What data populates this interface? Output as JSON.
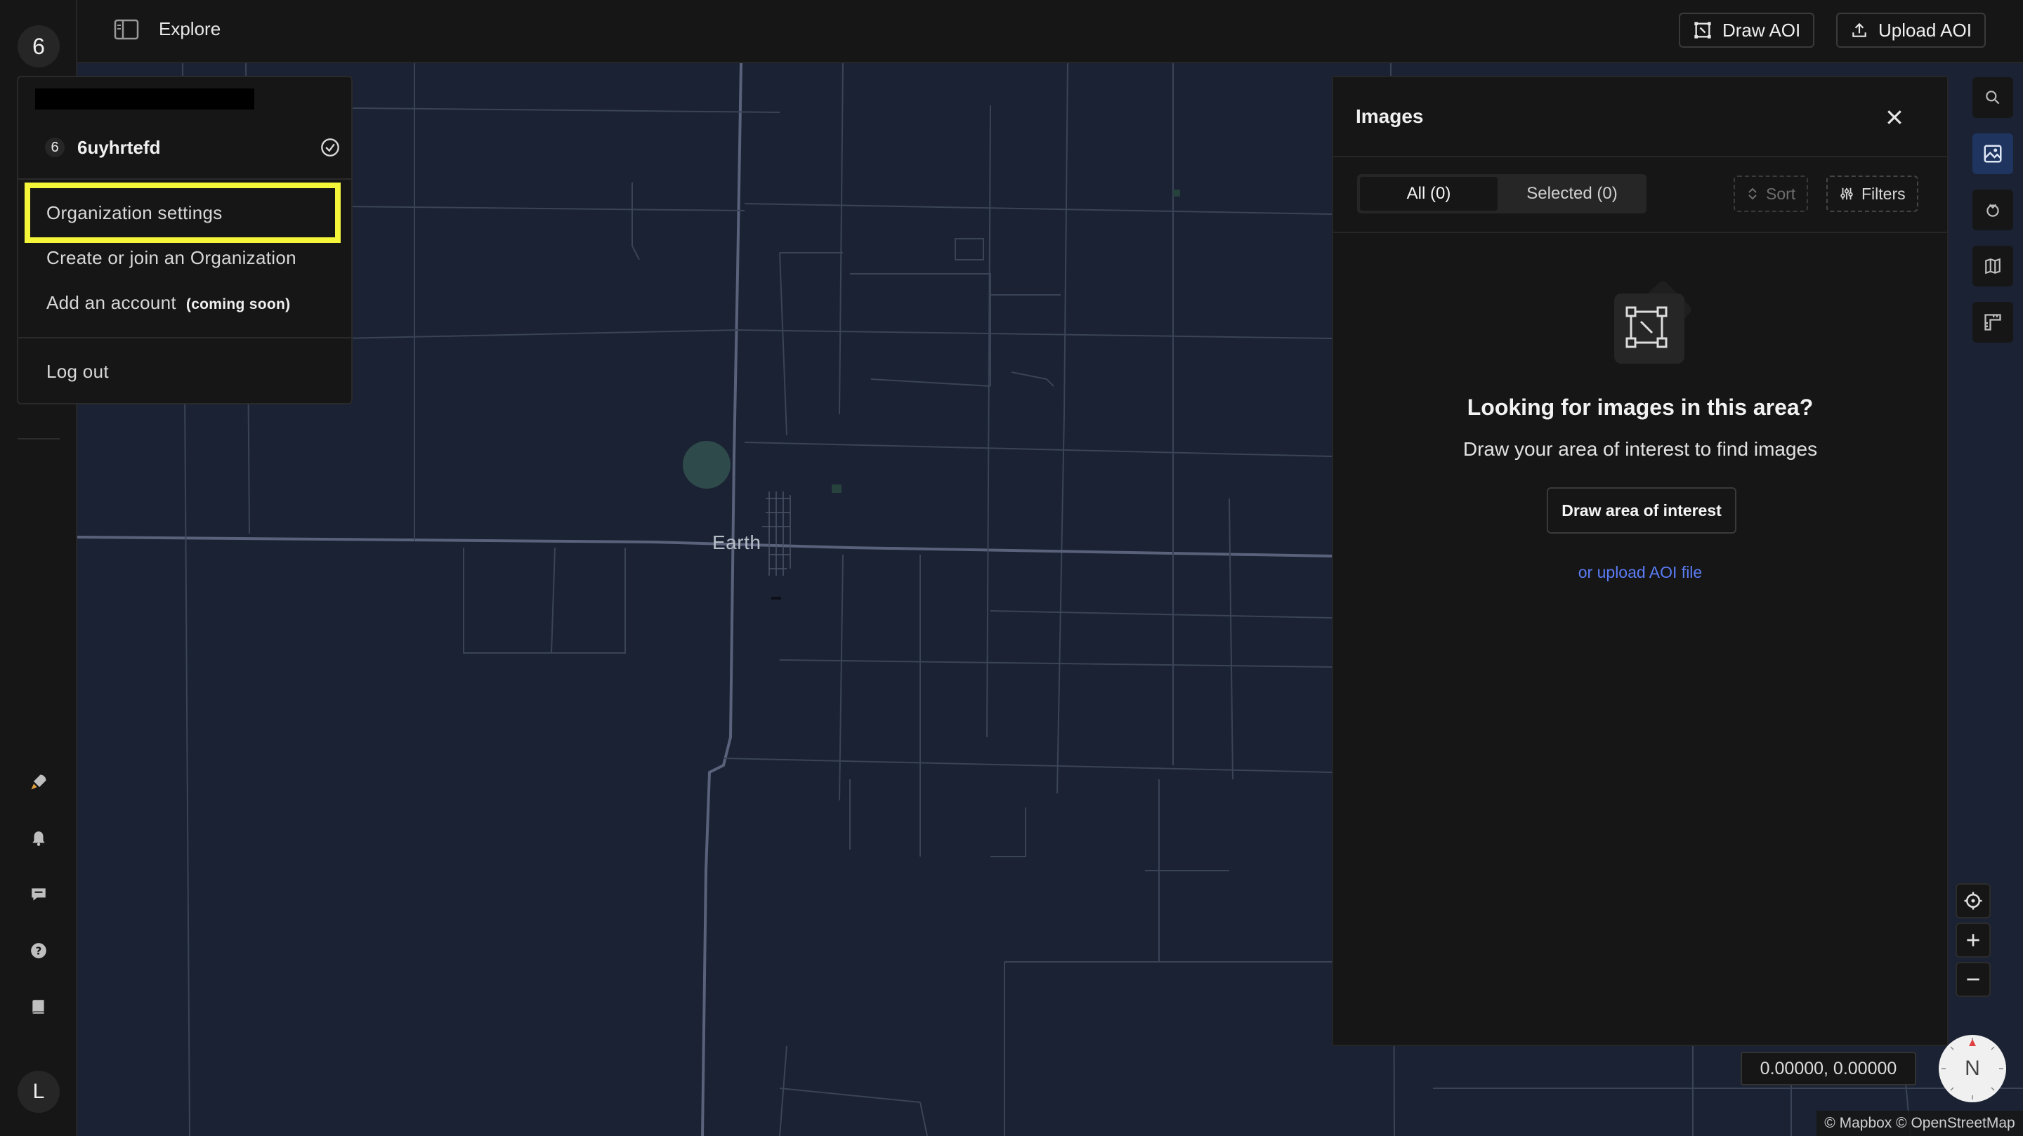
{
  "rail": {
    "top_avatar": "6",
    "bottom_avatar": "L",
    "icons": [
      "rocket-icon",
      "bell-icon",
      "chat-icon",
      "help-icon",
      "book-icon"
    ]
  },
  "header": {
    "title": "Explore",
    "draw_aoi": "Draw AOI",
    "upload_aoi": "Upload AOI"
  },
  "account_menu": {
    "org_badge": "6",
    "org_name": "6uyhrtefd",
    "items": {
      "org_settings": "Organization settings",
      "create_join": "Create or join an Organization",
      "add_account": "Add an account",
      "coming_soon": "(coming soon)",
      "logout": "Log out"
    }
  },
  "map": {
    "place_label": "Earth",
    "coords": "0.00000, 0.00000",
    "compass": "N",
    "attribution": "© Mapbox © OpenStreetMap"
  },
  "images_panel": {
    "title": "Images",
    "tabs": {
      "all": "All (0)",
      "selected": "Selected (0)"
    },
    "sort": "Sort",
    "filters": "Filters",
    "empty_title": "Looking for images in this area?",
    "empty_subtitle": "Draw your area of interest to find images",
    "draw_button": "Draw area of interest",
    "upload_link": "or upload AOI file"
  },
  "colors": {
    "highlight": "#f5f53a",
    "link": "#5b7cf5",
    "active_tool": "#1f3560",
    "map_bg": "#1a2233"
  }
}
